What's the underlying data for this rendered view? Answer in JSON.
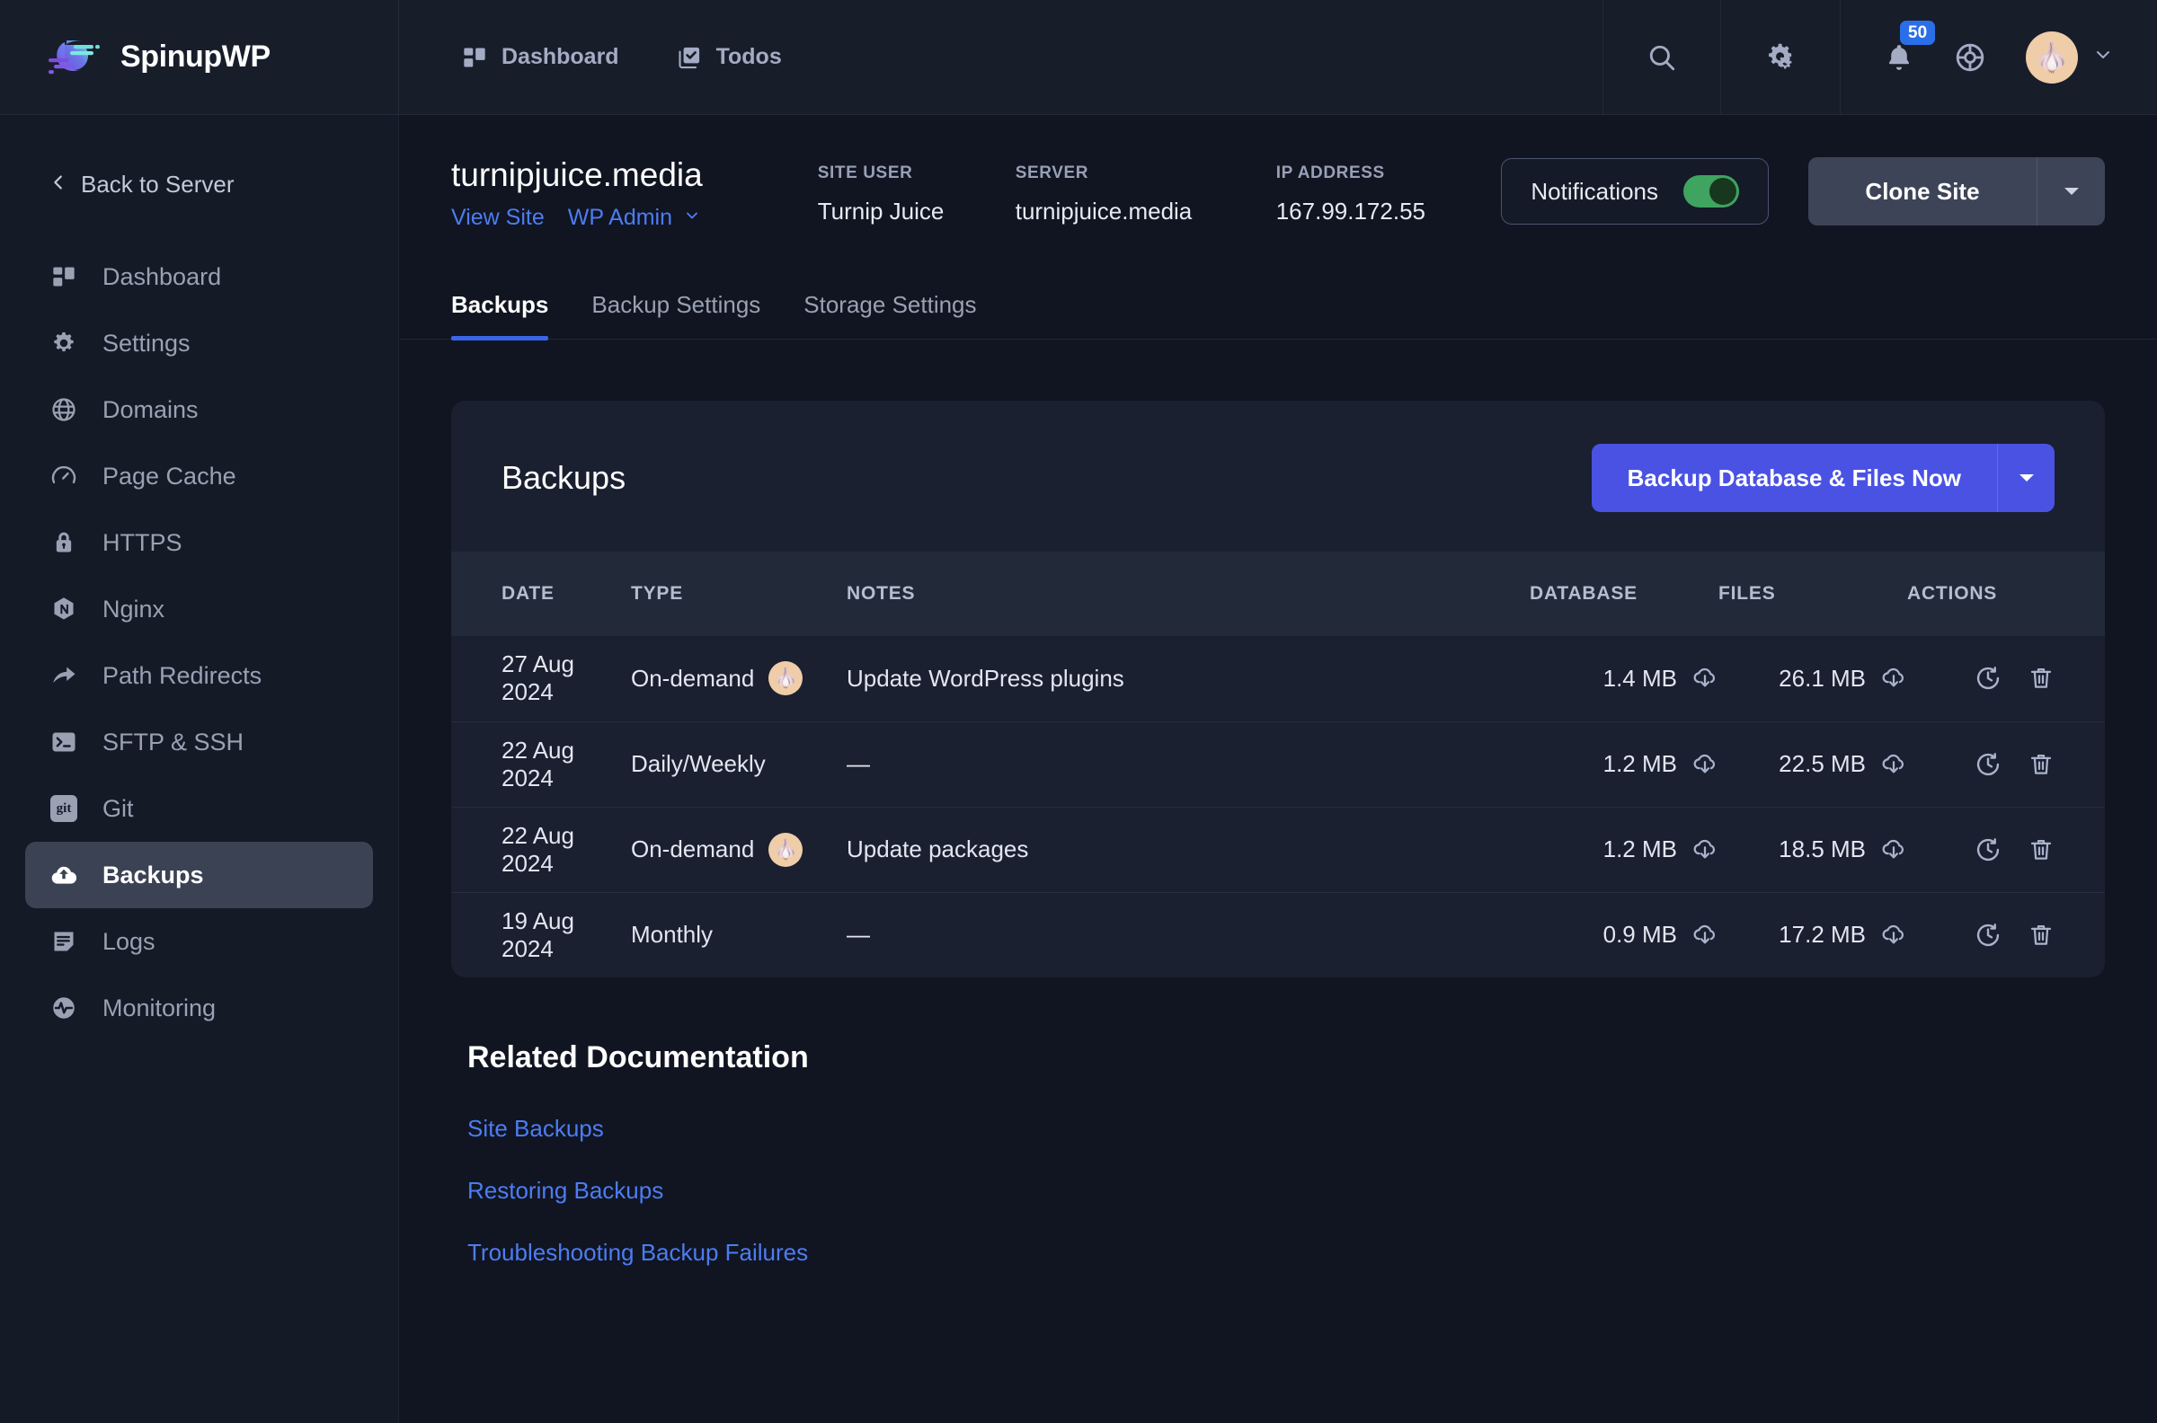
{
  "brand": {
    "name": "SpinupWP"
  },
  "topnav": {
    "items": [
      {
        "label": "Dashboard",
        "icon": "grid-icon"
      },
      {
        "label": "Todos",
        "icon": "check-square-icon"
      }
    ],
    "search_icon": "search-icon",
    "settings_icon": "gears-icon",
    "notifications_icon": "bell-icon",
    "notifications_count": "50",
    "help_icon": "life-ring-icon",
    "avatar_icon": "user-avatar",
    "avatar_emoji": "🧄",
    "avatar_caret": "chevron-down-icon"
  },
  "sidebar": {
    "back_label": "Back to Server",
    "items": [
      {
        "label": "Dashboard",
        "icon": "grid-icon",
        "active": false
      },
      {
        "label": "Settings",
        "icon": "gear-icon",
        "active": false
      },
      {
        "label": "Domains",
        "icon": "globe-icon",
        "active": false
      },
      {
        "label": "Page Cache",
        "icon": "gauge-icon",
        "active": false
      },
      {
        "label": "HTTPS",
        "icon": "lock-icon",
        "active": false
      },
      {
        "label": "Nginx",
        "icon": "nginx-icon",
        "active": false
      },
      {
        "label": "Path Redirects",
        "icon": "arrow-redirect-icon",
        "active": false
      },
      {
        "label": "SFTP & SSH",
        "icon": "terminal-icon",
        "active": false
      },
      {
        "label": "Git",
        "icon": "git-icon",
        "active": false
      },
      {
        "label": "Backups",
        "icon": "cloud-upload-icon",
        "active": true
      },
      {
        "label": "Logs",
        "icon": "document-icon",
        "active": false
      },
      {
        "label": "Monitoring",
        "icon": "pulse-icon",
        "active": false
      }
    ]
  },
  "site_header": {
    "title": "turnipjuice.media",
    "view_site": "View Site",
    "wp_admin": "WP Admin",
    "meta": [
      {
        "label": "SITE USER",
        "value": "Turnip Juice"
      },
      {
        "label": "SERVER",
        "value": "turnipjuice.media"
      },
      {
        "label": "IP ADDRESS",
        "value": "167.99.172.55"
      }
    ],
    "notifications_label": "Notifications",
    "notifications_on": true,
    "clone_label": "Clone Site"
  },
  "tabs": [
    {
      "label": "Backups",
      "active": true
    },
    {
      "label": "Backup Settings",
      "active": false
    },
    {
      "label": "Storage Settings",
      "active": false
    }
  ],
  "card": {
    "title": "Backups",
    "primary_button": "Backup Database & Files Now"
  },
  "table": {
    "headers": [
      "DATE",
      "TYPE",
      "NOTES",
      "DATABASE",
      "FILES",
      "ACTIONS"
    ],
    "rows": [
      {
        "date": "27 Aug 2024",
        "type": "On-demand",
        "has_avatar": true,
        "avatar_emoji": "🧄",
        "notes": "Update WordPress plugins",
        "database": "1.4 MB",
        "files": "26.1 MB"
      },
      {
        "date": "22 Aug 2024",
        "type": "Daily/Weekly",
        "has_avatar": false,
        "avatar_emoji": "",
        "notes": "—",
        "database": "1.2 MB",
        "files": "22.5 MB"
      },
      {
        "date": "22 Aug 2024",
        "type": "On-demand",
        "has_avatar": true,
        "avatar_emoji": "🧄",
        "notes": "Update packages",
        "database": "1.2 MB",
        "files": "18.5 MB"
      },
      {
        "date": "19 Aug 2024",
        "type": "Monthly",
        "has_avatar": false,
        "avatar_emoji": "",
        "notes": "—",
        "database": "0.9 MB",
        "files": "17.2 MB"
      }
    ]
  },
  "docs": {
    "title": "Related Documentation",
    "links": [
      "Site Backups",
      "Restoring Backups",
      "Troubleshooting Backup Failures"
    ]
  },
  "colors": {
    "page_bg": "#101521",
    "panel_bg": "#181d2a",
    "sidebar_bg": "#151a27",
    "card_bg": "#1a2030",
    "table_head_bg": "#222938",
    "primary": "#4a52e4",
    "link": "#4d7cf3",
    "tab_active_underline": "#3b65e8",
    "toggle_on": "#3fa45f",
    "badge": "#2b6fe8"
  }
}
